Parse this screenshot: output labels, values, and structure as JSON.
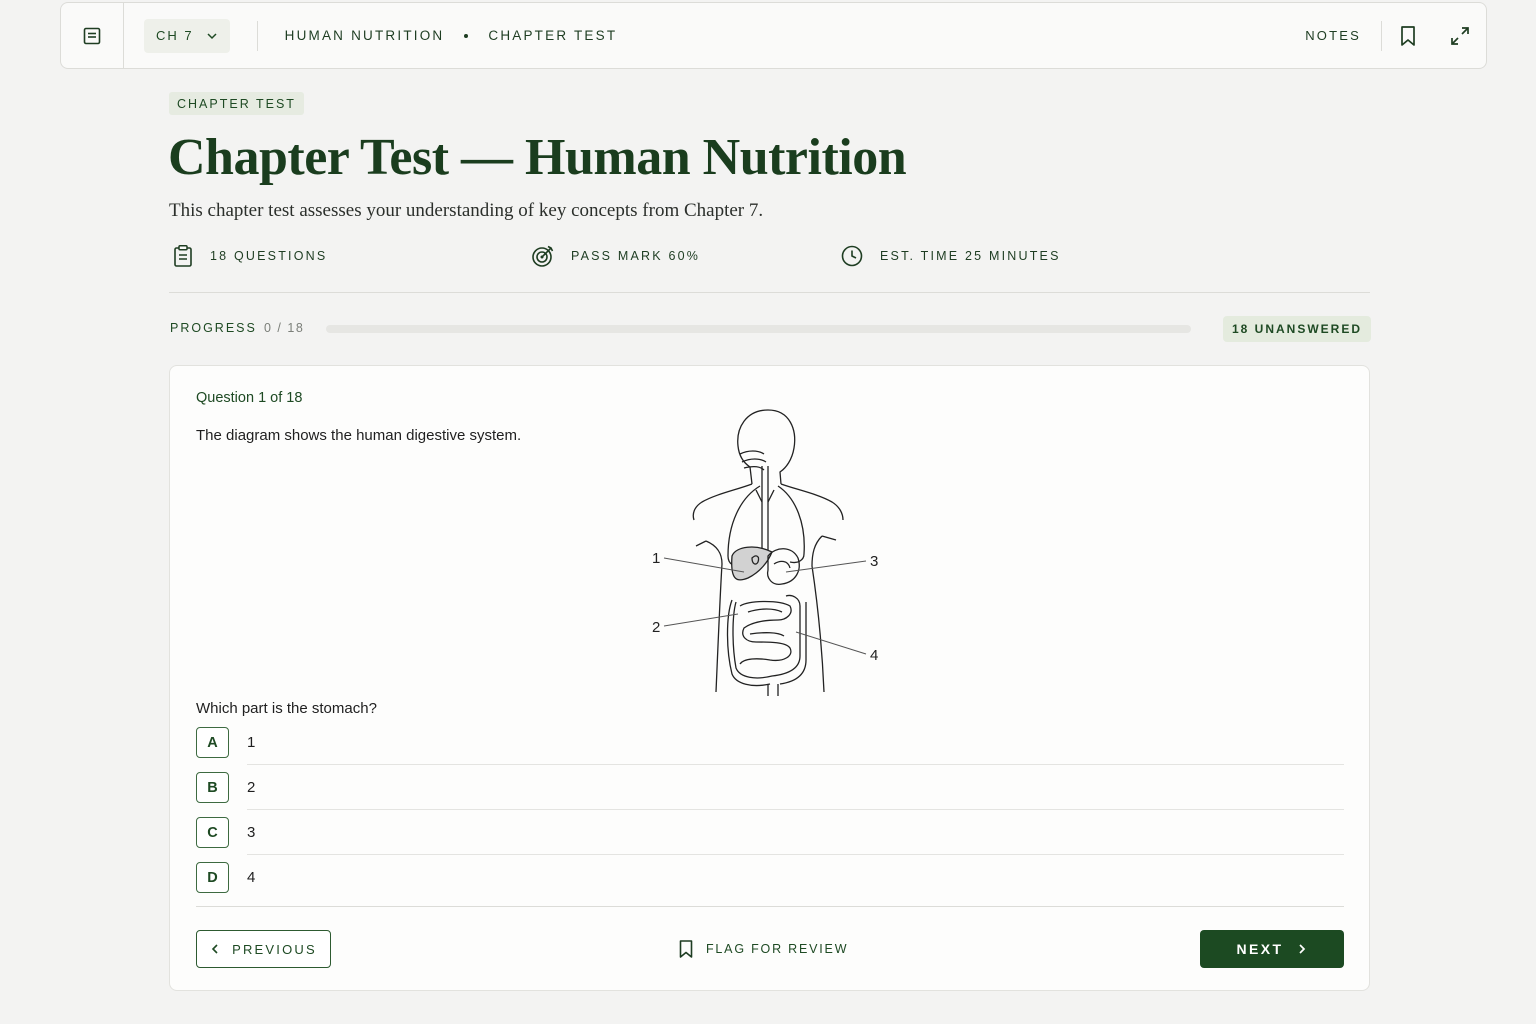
{
  "header": {
    "chapter_select": "CH 7",
    "breadcrumbs": [
      "HUMAN NUTRITION",
      "CHAPTER TEST"
    ],
    "notes_label": "NOTES"
  },
  "page": {
    "tag": "CHAPTER TEST",
    "title": "Chapter Test — Human Nutrition",
    "subtitle": "This chapter test assesses your understanding of key concepts from Chapter 7.",
    "meta": [
      {
        "icon": "clipboard-icon",
        "label": "18 QUESTIONS"
      },
      {
        "icon": "target-icon",
        "label": "PASS MARK 60%"
      },
      {
        "icon": "clock-icon",
        "label": "EST. TIME 25 MINUTES"
      }
    ]
  },
  "progress": {
    "label": "PROGRESS",
    "count": "0 / 18",
    "fraction": 0,
    "badge": "18 UNANSWERED"
  },
  "question": {
    "number": "Question 1 of 18",
    "stem": "The diagram shows the human digestive system.",
    "diagram_labels": [
      "1",
      "2",
      "3",
      "4"
    ],
    "ask": "Which part is the stomach?",
    "options": [
      {
        "key": "A",
        "text": "1"
      },
      {
        "key": "B",
        "text": "2"
      },
      {
        "key": "C",
        "text": "3"
      },
      {
        "key": "D",
        "text": "4"
      }
    ]
  },
  "footer": {
    "previous": "PREVIOUS",
    "flag": "FLAG FOR REVIEW",
    "next": "NEXT"
  },
  "colors": {
    "accent": "#1c4a22",
    "background": "#f3f3f2",
    "card": "#fdfdfc"
  }
}
